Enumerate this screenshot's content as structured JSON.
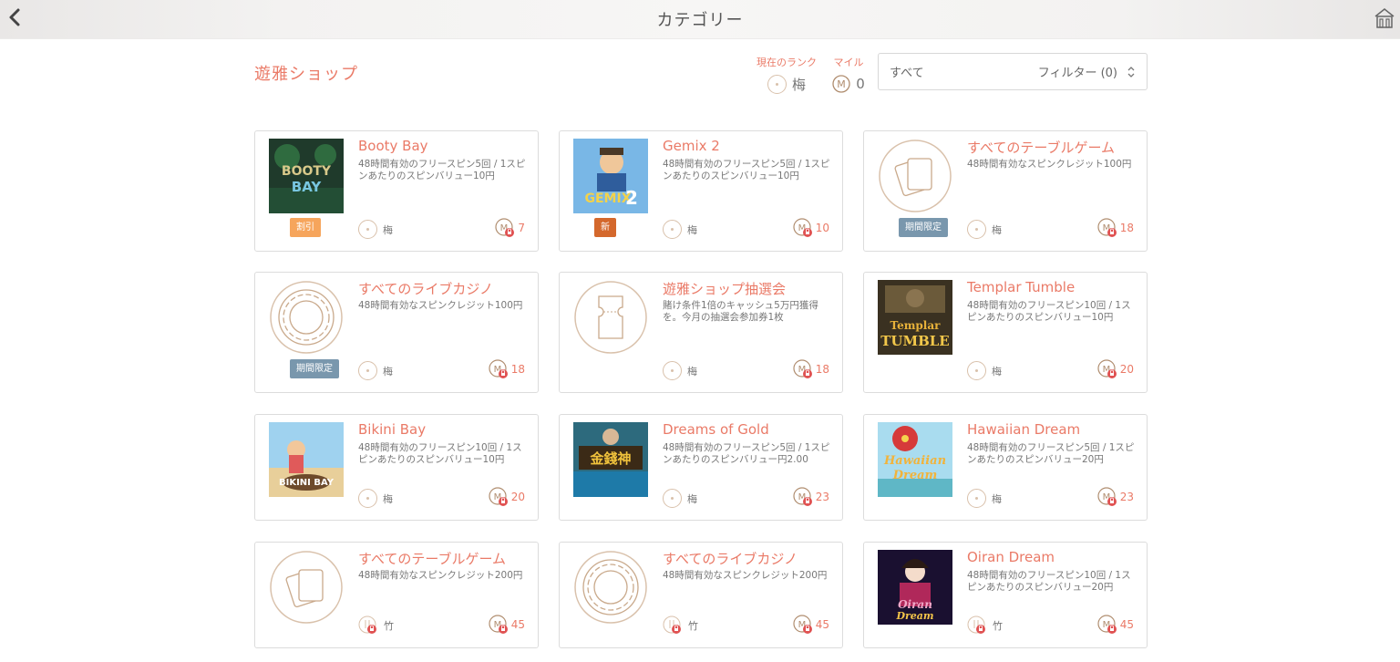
{
  "header": {
    "title": "カテゴリー"
  },
  "shop": {
    "title": "遊雅ショップ"
  },
  "rank": {
    "label": "現在のランク",
    "value": "梅"
  },
  "miles": {
    "label": "マイル",
    "value": "0"
  },
  "filter": {
    "selected": "すべて",
    "label": "フィルター (0)"
  },
  "colors": {
    "accent": "#ea7a67",
    "badge_sale": "#f6a55c",
    "badge_new": "#d4682c",
    "badge_limited": "#7997ad",
    "line_gold": "#d9c1ab"
  },
  "cards": [
    {
      "title": "Booty Bay",
      "desc": "48時間有効のフリースピン5回 / 1スピンあたりのスピンバリュー10円",
      "rank": "梅",
      "miles": "7",
      "badge": "割引",
      "thumb": "booty-bay"
    },
    {
      "title": "Gemix 2",
      "desc": "48時間有効のフリースピン5回 / 1スピンあたりのスピンバリュー10円",
      "rank": "梅",
      "miles": "10",
      "badge": "新",
      "thumb": "gemix-2"
    },
    {
      "title": "すべてのテーブルゲーム",
      "desc": "48時間有効なスピンクレジット100円",
      "rank": "梅",
      "miles": "18",
      "badge": "期間限定",
      "thumb": "cards-icon"
    },
    {
      "title": "すべてのライブカジノ",
      "desc": "48時間有効なスピンクレジット100円",
      "rank": "梅",
      "miles": "18",
      "badge": "期間限定",
      "thumb": "chip-icon"
    },
    {
      "title": "遊雅ショップ抽選会",
      "desc": "賭け条件1倍のキャッシュ5万円獲得を。今月の抽選会参加券1枚",
      "rank": "梅",
      "miles": "18",
      "badge": "",
      "thumb": "ticket-icon"
    },
    {
      "title": "Templar Tumble",
      "desc": "48時間有効のフリースピン10回 / 1スピンあたりのスピンバリュー10円",
      "rank": "梅",
      "miles": "20",
      "badge": "",
      "thumb": "templar-tumble"
    },
    {
      "title": "Bikini Bay",
      "desc": "48時間有効のフリースピン10回 / 1スピンあたりのスピンバリュー10円",
      "rank": "梅",
      "miles": "20",
      "badge": "",
      "thumb": "bikini-bay"
    },
    {
      "title": "Dreams of Gold",
      "desc": "48時間有効のフリースピン5回 / 1スピンあたりのスピンバリュー円2.00",
      "rank": "梅",
      "miles": "23",
      "badge": "",
      "thumb": "dreams-of-gold"
    },
    {
      "title": "Hawaiian Dream",
      "desc": "48時間有効のフリースピン5回 / 1スピンあたりのスピンバリュー20円",
      "rank": "梅",
      "miles": "23",
      "badge": "",
      "thumb": "hawaiian-dream"
    },
    {
      "title": "すべてのテーブルゲーム",
      "desc": "48時間有効なスピンクレジット200円",
      "rank": "竹",
      "miles": "45",
      "badge": "",
      "thumb": "cards-icon"
    },
    {
      "title": "すべてのライブカジノ",
      "desc": "48時間有効なスピンクレジット200円",
      "rank": "竹",
      "miles": "45",
      "badge": "",
      "thumb": "chip-icon"
    },
    {
      "title": "Oiran Dream",
      "desc": "48時間有効のフリースピン10回 / 1スピンあたりのスピンバリュー20円",
      "rank": "竹",
      "miles": "45",
      "badge": "",
      "thumb": "oiran-dream"
    }
  ]
}
